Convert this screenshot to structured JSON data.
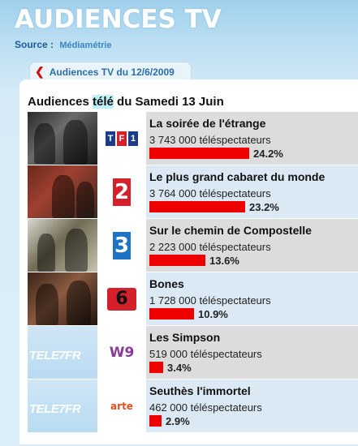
{
  "header": {
    "title": "AUDIENCES TV",
    "source_label": "Source :",
    "source_value": "Médiamétrie"
  },
  "back_tab": {
    "label": "Audiences TV du 12/6/2009"
  },
  "panel": {
    "title_before": "Audiences ",
    "title_highlight": "télé",
    "title_after": " du Samedi 13 Juin"
  },
  "colors": {
    "bar": "#ee0000",
    "row_grey": "#dcdcdc",
    "row_blue": "#dbe9f5"
  },
  "rows": [
    {
      "thumb": "photo",
      "channel": "TF1",
      "channel_icon": "tf1-logo",
      "program": "La soirée de l'étrange",
      "viewers": "3 743 000 téléspectateurs",
      "share": "24.2%",
      "share_value": 24.2
    },
    {
      "thumb": "photo",
      "channel": "France 2",
      "channel_icon": "france2-logo",
      "program": "Le plus grand cabaret du monde",
      "viewers": "3 764 000 téléspectateurs",
      "share": "23.2%",
      "share_value": 23.2
    },
    {
      "thumb": "photo",
      "channel": "France 3",
      "channel_icon": "france3-logo",
      "program": "Sur le chemin de Compostelle",
      "viewers": "2 223 000 téléspectateurs",
      "share": "13.6%",
      "share_value": 13.6
    },
    {
      "thumb": "photo",
      "channel": "M6",
      "channel_icon": "m6-logo",
      "program": "Bones",
      "viewers": "1 728 000 téléspectateurs",
      "share": "10.9%",
      "share_value": 10.9
    },
    {
      "thumb": "tele-placeholder",
      "thumb_text": "TELE7FR",
      "channel": "W9",
      "channel_icon": "w9-logo",
      "program": "Les Simpson",
      "viewers": "519 000 téléspectateurs",
      "share": "3.4%",
      "share_value": 3.4
    },
    {
      "thumb": "tele-placeholder",
      "thumb_text": "TELE7FR",
      "channel": "arte",
      "channel_icon": "arte-logo",
      "program": "Seuthès l'immortel",
      "viewers": "462 000 téléspectateurs",
      "share": "2.9%",
      "share_value": 2.9
    }
  ]
}
